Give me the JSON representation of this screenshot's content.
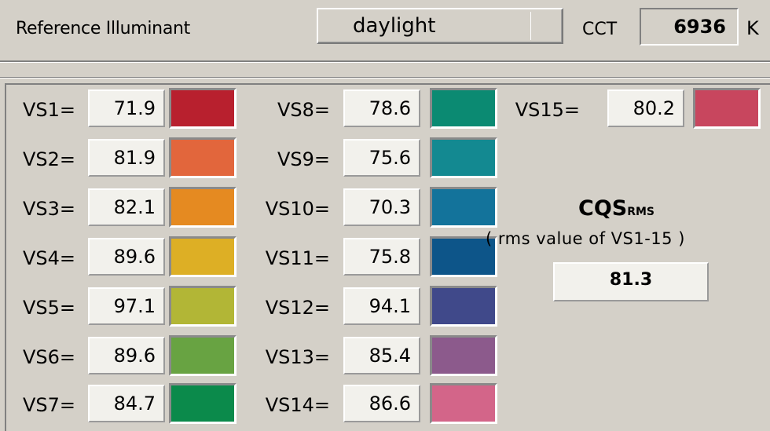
{
  "header": {
    "reference_label": "Reference Illuminant",
    "illuminant_value": "daylight",
    "cct_label": "CCT",
    "cct_value": "6936",
    "cct_unit": "K"
  },
  "samples": [
    {
      "label": "VS1=",
      "value": "71.9",
      "color": "#b8202e"
    },
    {
      "label": "VS2=",
      "value": "81.9",
      "color": "#e2663c"
    },
    {
      "label": "VS3=",
      "value": "82.1",
      "color": "#e58a21"
    },
    {
      "label": "VS4=",
      "value": "89.6",
      "color": "#ddaf25"
    },
    {
      "label": "VS5=",
      "value": "97.1",
      "color": "#b2b636"
    },
    {
      "label": "VS6=",
      "value": "89.6",
      "color": "#68a342"
    },
    {
      "label": "VS7=",
      "value": "84.7",
      "color": "#0b8a4b"
    },
    {
      "label": "VS8=",
      "value": "78.6",
      "color": "#0b8a72"
    },
    {
      "label": "VS9=",
      "value": "75.6",
      "color": "#138991"
    },
    {
      "label": "VS10=",
      "value": "70.3",
      "color": "#13739b"
    },
    {
      "label": "VS11=",
      "value": "75.8",
      "color": "#0d5589"
    },
    {
      "label": "VS12=",
      "value": "94.1",
      "color": "#40498a"
    },
    {
      "label": "VS13=",
      "value": "85.4",
      "color": "#8c5a8c"
    },
    {
      "label": "VS14=",
      "value": "86.6",
      "color": "#d36589"
    },
    {
      "label": "VS15=",
      "value": "80.2",
      "color": "#c8465e"
    }
  ],
  "cqs": {
    "title": "CQS",
    "subscript": "RMS",
    "description": "( rms value of VS1-15 )",
    "value": "81.3"
  }
}
